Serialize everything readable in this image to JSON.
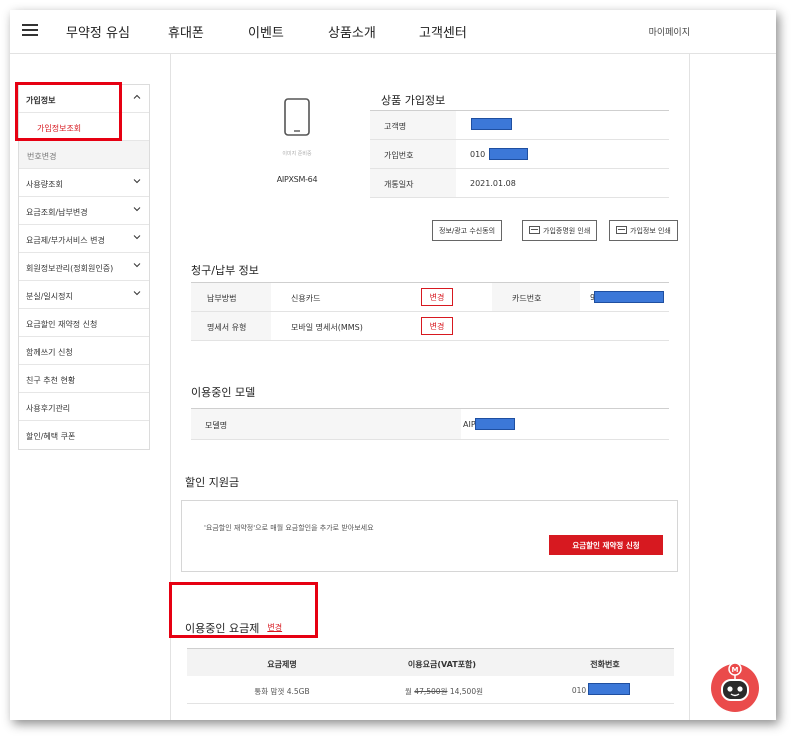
{
  "nav": {
    "items": [
      "무약정 유심",
      "휴대폰",
      "이벤트",
      "상품소개",
      "고객센터"
    ],
    "mypage": "마이페이지"
  },
  "sidebar": {
    "items": [
      {
        "label": "가입정보",
        "expanded": true
      },
      {
        "label": "가입정보조회",
        "active": true
      },
      {
        "label": "번호변경"
      },
      {
        "label": "사용량조회"
      },
      {
        "label": "요금조회/납부변경"
      },
      {
        "label": "요금제/부가서비스 변경"
      },
      {
        "label": "회원정보관리(정회원인증)"
      },
      {
        "label": "분실/일시정지"
      },
      {
        "label": "요금할인 재약정 신청"
      },
      {
        "label": "함께쓰기 신청"
      },
      {
        "label": "친구 추천 현황"
      },
      {
        "label": "사용후기관리"
      },
      {
        "label": "할인/혜택 쿠폰"
      }
    ]
  },
  "product": {
    "title": "상품 가입정보",
    "no_image": "이미지 준비중",
    "model_code": "AIPXSM-64",
    "rows": [
      {
        "label": "고객명",
        "value": ""
      },
      {
        "label": "가입번호",
        "value": "010"
      },
      {
        "label": "개통일자",
        "value": "2021.01.08"
      }
    ],
    "buttons": [
      "정보/광고 수신동의",
      "가입증명원 인쇄",
      "가입정보 인쇄"
    ]
  },
  "billing": {
    "title": "청구/납부 정보",
    "payment_label": "납부방법",
    "payment_value": "신용카드",
    "card_label": "카드번호",
    "card_value": "9",
    "statement_label": "명세서 유형",
    "statement_value": "모바일 명세서(MMS)",
    "change_label": "변경"
  },
  "model": {
    "title": "이용중인 모델",
    "label": "모델명",
    "value": "AIP"
  },
  "discount": {
    "title": "할인 지원금",
    "text": "'요금할인 재약정'으로 매월 요금할인을 추가로 받아보세요",
    "button": "요금할인 재약정 신청"
  },
  "plan": {
    "title": "이용중인 요금제",
    "change_link": "변경",
    "headers": [
      "요금제명",
      "이용요금(VAT포함)",
      "전화번호"
    ],
    "row": {
      "name": "통화 맘껏 4.5GB",
      "price_prefix": "월",
      "original_price": "47,500원",
      "price": "14,500원",
      "phone": "010"
    }
  },
  "colors": {
    "accent": "#d71920",
    "highlight": "#e60012",
    "mask": "#3c78d8"
  }
}
